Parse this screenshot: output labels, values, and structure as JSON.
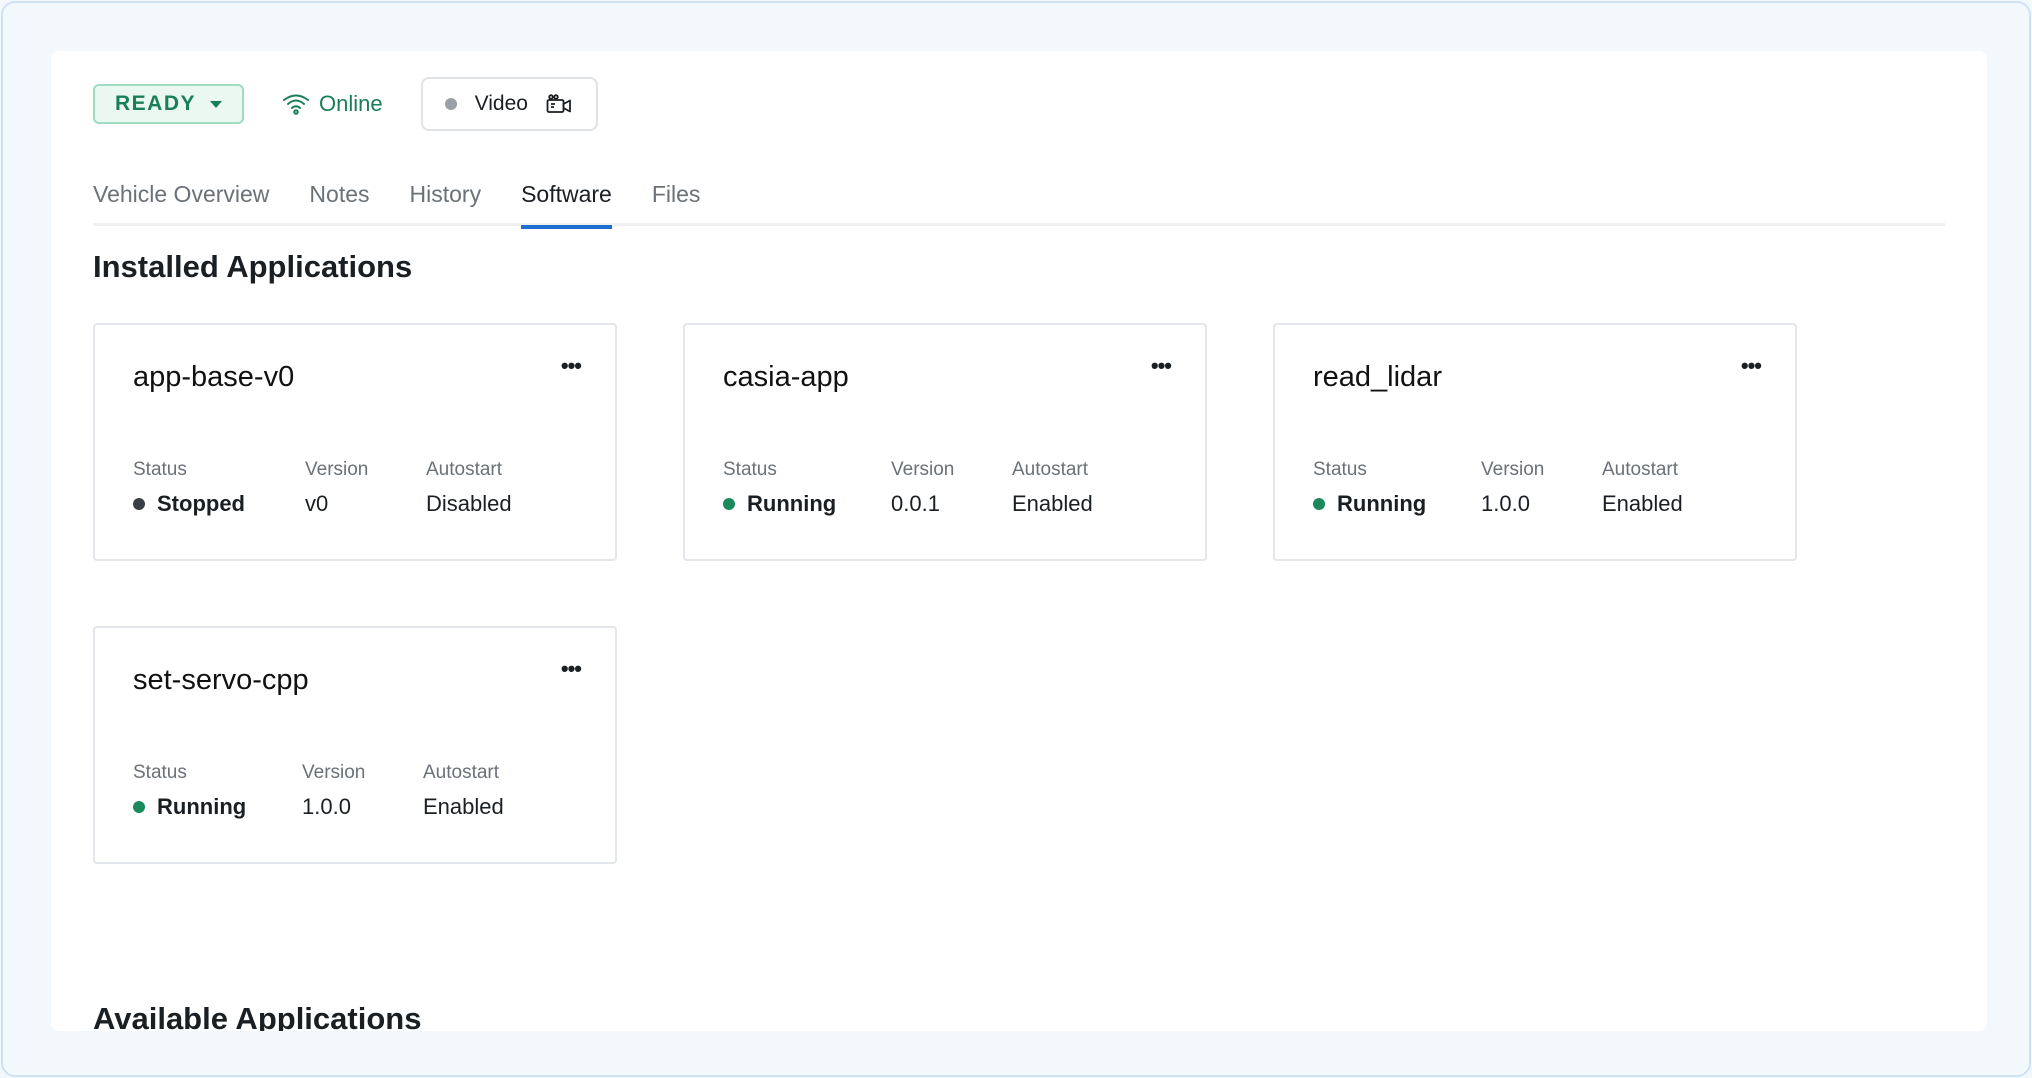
{
  "header": {
    "state_label": "READY",
    "connection_label": "Online",
    "video_label": "Video",
    "colors": {
      "ready": "#1a7f56",
      "online": "#1a7f56"
    }
  },
  "tabs": [
    {
      "label": "Vehicle Overview",
      "active": false
    },
    {
      "label": "Notes",
      "active": false
    },
    {
      "label": "History",
      "active": false
    },
    {
      "label": "Software",
      "active": true
    },
    {
      "label": "Files",
      "active": false
    }
  ],
  "installed": {
    "title": "Installed Applications",
    "labels": {
      "status": "Status",
      "version": "Version",
      "autostart": "Autostart"
    },
    "apps": [
      {
        "name": "app-base-v0",
        "status": "Stopped",
        "status_color": "#3a3f45",
        "version": "v0",
        "autostart": "Disabled"
      },
      {
        "name": "casia-app",
        "status": "Running",
        "status_color": "#1a8a5c",
        "version": "0.0.1",
        "autostart": "Enabled"
      },
      {
        "name": "read_lidar",
        "status": "Running",
        "status_color": "#1a8a5c",
        "version": "1.0.0",
        "autostart": "Enabled"
      },
      {
        "name": "set-servo-cpp",
        "status": "Running",
        "status_color": "#1a8a5c",
        "version": "1.0.0",
        "autostart": "Enabled"
      }
    ]
  },
  "available": {
    "title": "Available Applications"
  },
  "icons": {
    "caret": "caret-down-icon",
    "wifi": "wifi-icon",
    "video_dot": "status-dot-icon",
    "camera": "video-camera-icon",
    "more": "more-horizontal-icon"
  }
}
